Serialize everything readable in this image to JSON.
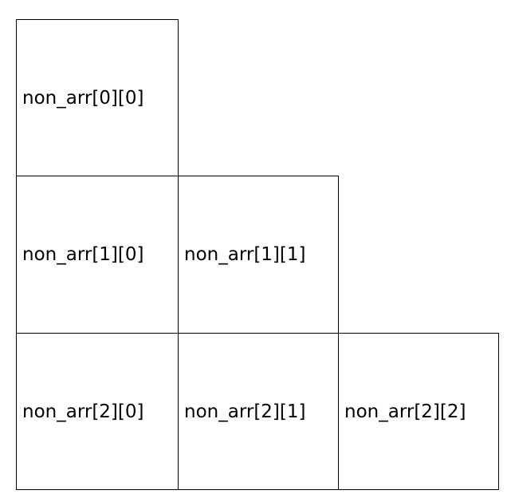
{
  "cells": [
    {
      "label": "non_arr[0][0]"
    },
    {
      "label": "non_arr[1][0]"
    },
    {
      "label": "non_arr[1][1]"
    },
    {
      "label": "non_arr[2][0]"
    },
    {
      "label": "non_arr[2][1]"
    },
    {
      "label": "non_arr[2][2]"
    }
  ]
}
